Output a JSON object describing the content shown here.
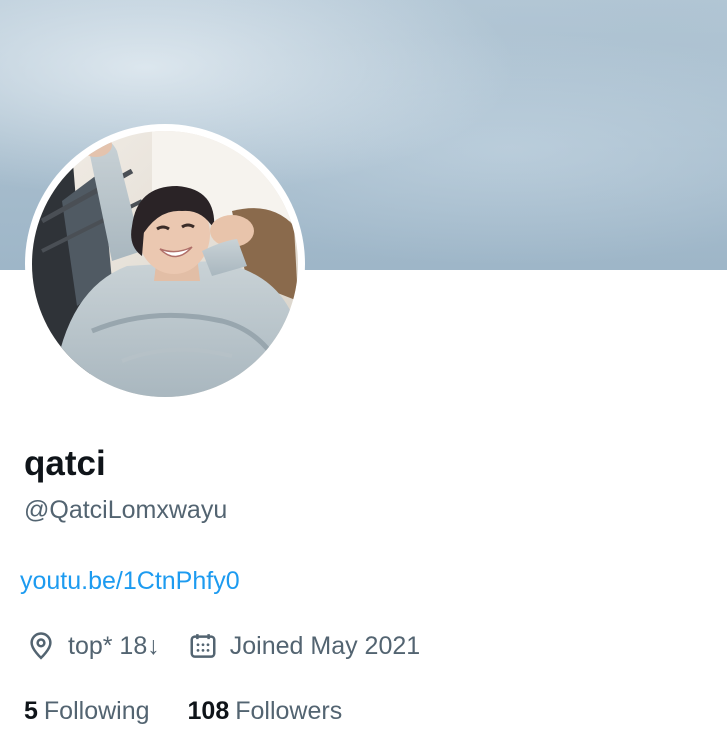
{
  "profile": {
    "display_name": "qatci",
    "handle": "@QatciLomxwayu",
    "bio_link": "youtu.be/1CtnPhfy0",
    "location": "top* 18↓",
    "joined": "Joined May 2021",
    "following_count": "5",
    "following_label": "Following",
    "followers_count": "108",
    "followers_label": "Followers"
  },
  "icons": {
    "location": "location-pin-icon",
    "joined": "calendar-icon"
  },
  "colors": {
    "link": "#1d9bf0",
    "text_primary": "#0f1419",
    "text_secondary": "#536471",
    "banner": "#a7bdcd"
  }
}
